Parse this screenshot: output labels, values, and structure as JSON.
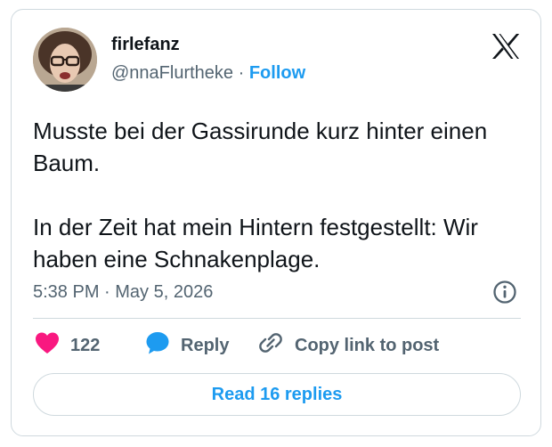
{
  "author": {
    "display_name": "firlefanz",
    "handle": "@nnaFlurtheke",
    "separator": "·",
    "follow_label": "Follow"
  },
  "tweet": {
    "paragraphs": [
      "Musste bei der Gassirunde kurz hinter einen Baum.",
      "In der Zeit hat mein Hintern festgestellt: Wir haben eine Schnakenplage."
    ],
    "timestamp": "5:38 PM · May 5, 2026"
  },
  "actions": {
    "like_count": "122",
    "reply_label": "Reply",
    "copy_link_label": "Copy link to post"
  },
  "read_replies_label": "Read 16 replies",
  "icons": {
    "logo": "x-logo-icon",
    "info": "info-icon",
    "like": "heart-icon",
    "reply": "speech-bubble-icon",
    "copy": "link-icon"
  },
  "colors": {
    "accent": "#1d9bf0",
    "like": "#f91880",
    "muted_text": "#536471",
    "primary_text": "#0f1419",
    "border": "#cfd9de"
  }
}
